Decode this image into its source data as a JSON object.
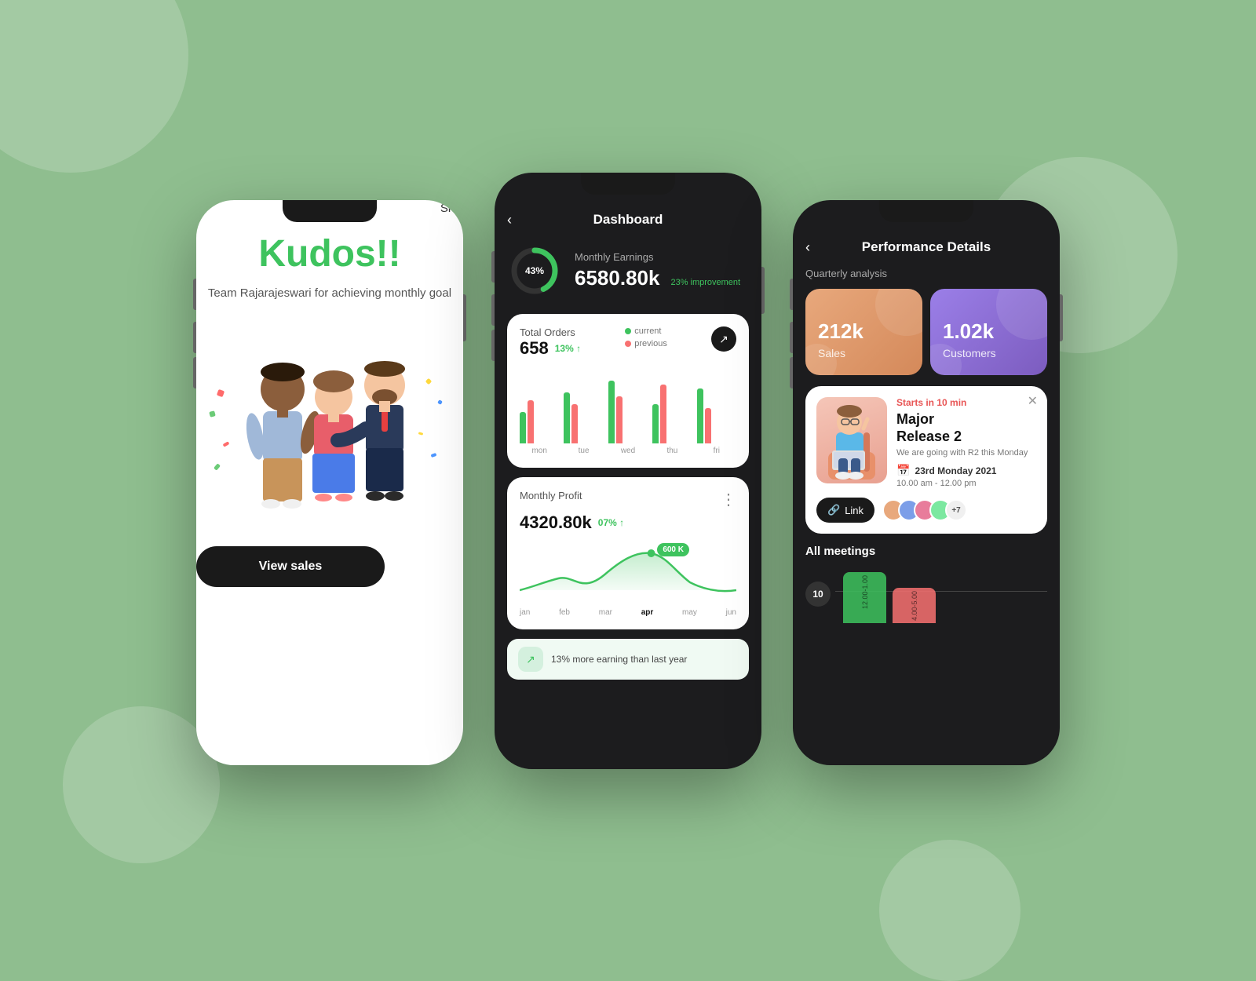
{
  "background": {
    "color": "#8fbe8f"
  },
  "phone1": {
    "nav": {
      "back": "‹",
      "skip": "Skip"
    },
    "kudos_title": "Kudos!!",
    "kudos_subtitle": "Team Rajarajeswari for achieving\nmonthly goal",
    "view_sales_btn": "View sales"
  },
  "phone2": {
    "header": {
      "back": "‹",
      "title": "Dashboard"
    },
    "earnings": {
      "label": "Monthly Earnings",
      "value": "6580.80k",
      "improvement": "23% improvement",
      "pct": "43%"
    },
    "total_orders": {
      "title": "Total Orders",
      "value": "658",
      "pct": "13%",
      "legend_current": "current",
      "legend_previous": "previous"
    },
    "monthly_profit": {
      "title": "Monthly Profit",
      "value": "4320.80k",
      "pct": "07%",
      "tooltip": "600 K"
    },
    "month_labels": [
      "jan",
      "feb",
      "mar",
      "apr",
      "may",
      "jun"
    ],
    "active_month": "apr",
    "footer_text": "13% more earning than last year",
    "bars": [
      {
        "current": 40,
        "previous": 55
      },
      {
        "current": 65,
        "previous": 50
      },
      {
        "current": 80,
        "previous": 60
      },
      {
        "current": 50,
        "previous": 75
      },
      {
        "current": 70,
        "previous": 45
      }
    ],
    "bar_labels": [
      "mon",
      "tue",
      "wed",
      "thu",
      "fri"
    ]
  },
  "phone3": {
    "header": {
      "back": "‹",
      "title": "Performance Details"
    },
    "quarterly_label": "Quarterly analysis",
    "stats": [
      {
        "value": "212k",
        "name": "Sales",
        "theme": "orange"
      },
      {
        "value": "1.02k",
        "name": "Customers",
        "theme": "purple"
      }
    ],
    "event": {
      "starts": "Starts in 10 min",
      "title": "Major\nRelease 2",
      "desc": "We are going with R2 this Monday",
      "date": "23rd Monday 2021",
      "time": "10.00 am - 12.00 pm",
      "link_btn": "Link",
      "close": "✕"
    },
    "avatars": [
      {
        "color": "#e8a87c"
      },
      {
        "color": "#7c9ee8"
      },
      {
        "color": "#e87c9b"
      },
      {
        "color": "#7ce8a0"
      }
    ],
    "avatar_more": "+7",
    "all_meetings_label": "All meetings",
    "time_marker": "10",
    "timeline_bars": [
      {
        "color": "#3ec35e",
        "height": 60,
        "label": "12.00-1.00"
      },
      {
        "color": "#f87171",
        "height": 45,
        "label": "4.00-5.00"
      }
    ]
  }
}
